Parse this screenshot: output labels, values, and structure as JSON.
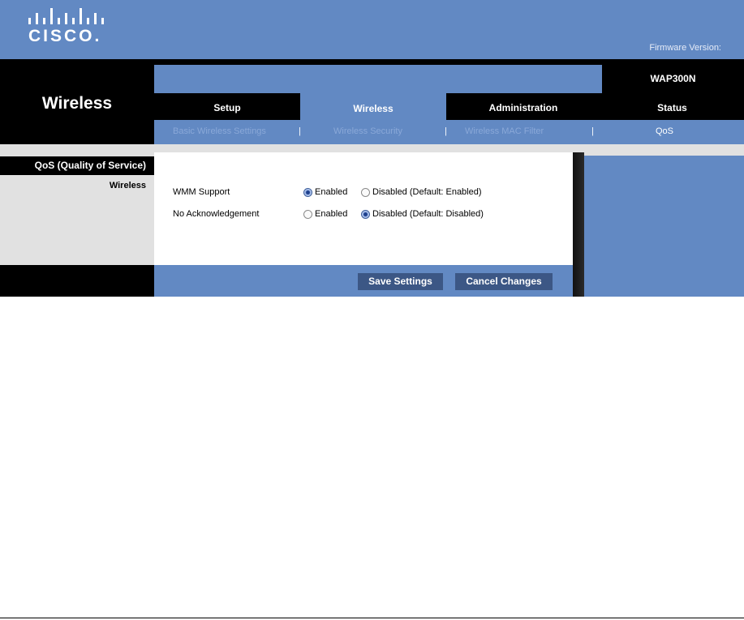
{
  "brand": {
    "logo_text": "CISCO.",
    "firmware_label": "Firmware Version:"
  },
  "header": {
    "section_title": "Wireless",
    "model": "WAP300N"
  },
  "tabs": [
    {
      "label": "Setup",
      "active": false
    },
    {
      "label": "Wireless",
      "active": true
    },
    {
      "label": "Administration",
      "active": false
    },
    {
      "label": "Status",
      "active": false
    }
  ],
  "subtabs": [
    {
      "label": "Basic Wireless Settings"
    },
    {
      "label": "Wireless Security"
    },
    {
      "label": "Wireless MAC Filter"
    },
    {
      "label": "QoS",
      "active": true
    }
  ],
  "subtab_separator": "|",
  "sidebar": {
    "heading": "QoS (Quality of Service)",
    "subheading": "Wireless"
  },
  "form": {
    "wmm": {
      "label": "WMM Support",
      "enabled_label": "Enabled",
      "disabled_label": "Disabled (Default: Enabled)",
      "selected": "enabled"
    },
    "no_ack": {
      "label": "No Acknowledgement",
      "enabled_label": "Enabled",
      "disabled_label": "Disabled (Default: Disabled)",
      "selected": "disabled"
    }
  },
  "buttons": {
    "save": "Save Settings",
    "cancel": "Cancel Changes"
  },
  "colors": {
    "brand_blue": "#6289c3",
    "black": "#000000",
    "grey": "#e1e1e1",
    "button": "#3c5785"
  }
}
